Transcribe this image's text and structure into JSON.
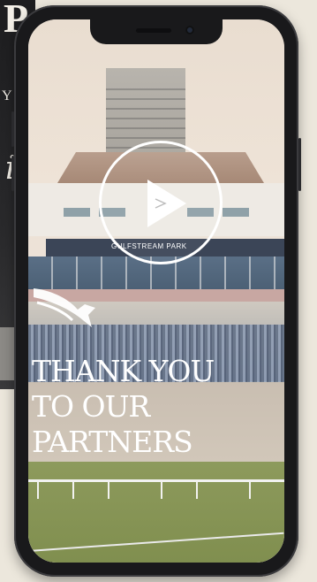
{
  "video": {
    "venue_sign": "GULFSTREAM PARK",
    "headline": {
      "line1": "THANK YOU",
      "line2": "TO OUR",
      "line3": "PARTNERS"
    },
    "play_icon": "play-icon"
  },
  "backdrop": {
    "letter": "P",
    "fragment": "Y",
    "script_fragment": "il"
  },
  "colors": {
    "phone_body": "#19191b",
    "headline": "#ffffff",
    "sign_band": "#3b4557"
  }
}
